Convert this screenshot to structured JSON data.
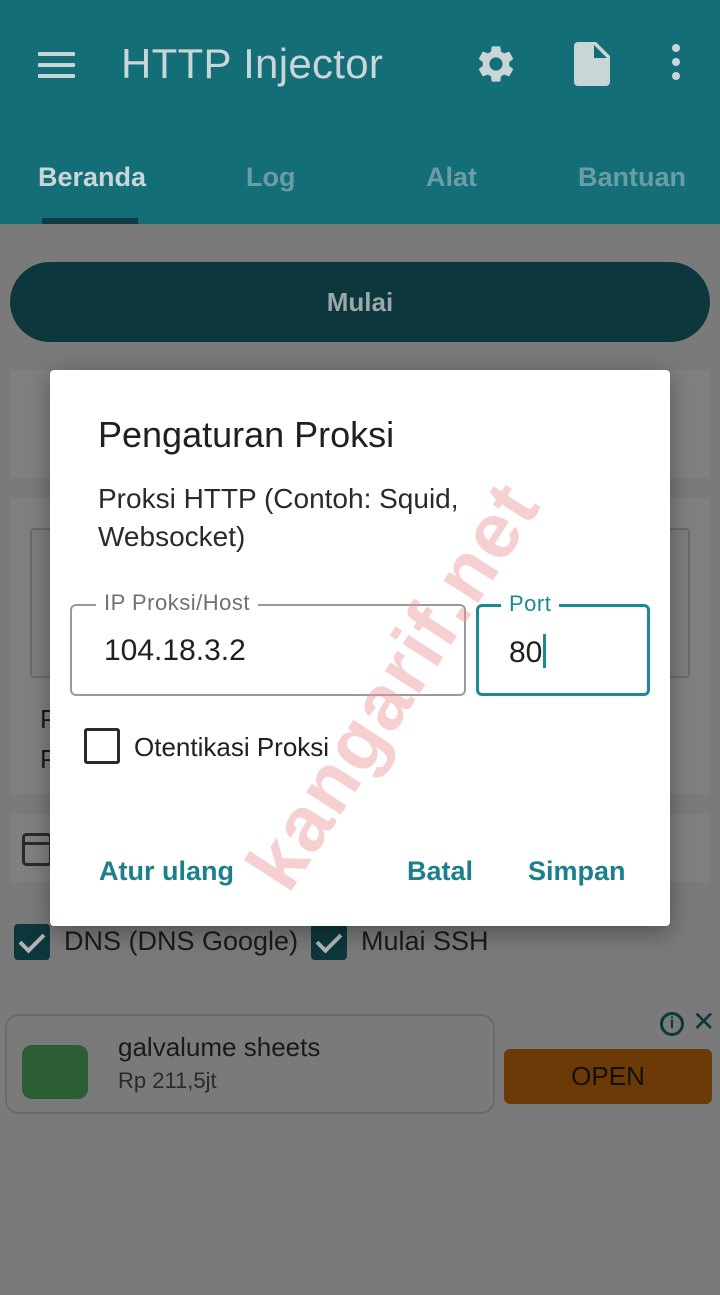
{
  "app": {
    "title": "HTTP Injector",
    "tabs": [
      {
        "label": "Beranda",
        "active": true
      },
      {
        "label": "Log",
        "active": false
      },
      {
        "label": "Alat",
        "active": false
      },
      {
        "label": "Bantuan",
        "active": false
      }
    ],
    "icons": [
      "menu-icon",
      "gear-icon",
      "document-icon",
      "more-vert-icon"
    ],
    "colors": {
      "appbar": "#146e78",
      "accent": "#1b8a97"
    }
  },
  "main": {
    "start_label": "Mulai",
    "checkboxes": [
      {
        "label": "DNS (DNS Google)",
        "checked": true
      },
      {
        "label": "Mulai SSH",
        "checked": true
      }
    ]
  },
  "dialog": {
    "title": "Pengaturan Proksi",
    "subtitle": "Proksi HTTP (Contoh: Squid, Websocket)",
    "host_label": "IP Proksi/Host",
    "host_value": "104.18.3.2",
    "port_label": "Port",
    "port_value": "80",
    "auth_label": "Otentikasi Proksi",
    "auth_checked": false,
    "reset_label": "Atur ulang",
    "cancel_label": "Batal",
    "save_label": "Simpan"
  },
  "ad": {
    "title": "galvalume sheets",
    "price": "Rp 211,5jt",
    "open_label": "OPEN"
  },
  "watermark": "kangarif.net"
}
